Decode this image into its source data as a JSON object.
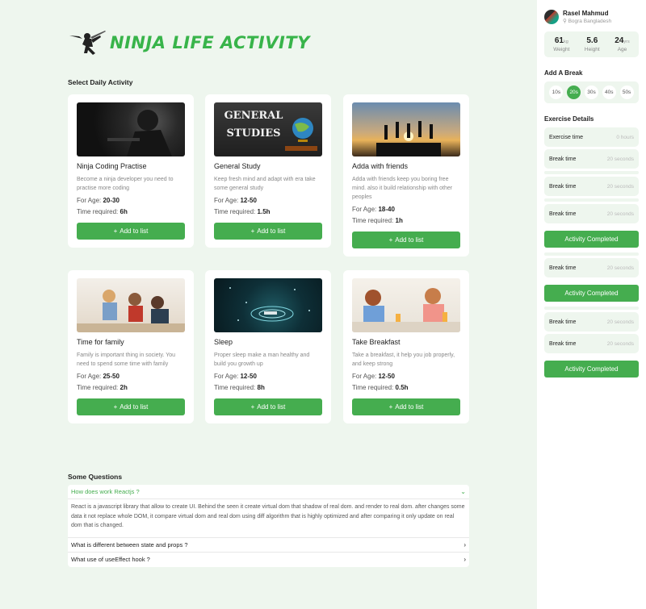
{
  "header": {
    "title": "NINJA LIFE ACTIVITY",
    "logo_icon": "ninja-icon"
  },
  "activities_title": "Select Daily Activity",
  "age_label": "For Age:",
  "time_label": "Time required:",
  "add_label": "Add to list",
  "activities": [
    {
      "title": "Ninja Coding Practise",
      "desc": "Become a ninja developer you need to practise more coding",
      "age": "20-30",
      "time": "6h",
      "image": "hooded-coder"
    },
    {
      "title": "General Study",
      "desc": "Keep fresh mind and adapt with era take some general study",
      "age": "12-50",
      "time": "1.5h",
      "image": "chalkboard-globe",
      "image_text": "GENERAL STUDIES"
    },
    {
      "title": "Adda with friends",
      "desc": "Adda with friends keep you boring free mind. also it build relationship with other peoples",
      "age": "18-40",
      "time": "1h",
      "image": "sunset-friends"
    },
    {
      "title": "Time for family",
      "desc": "Family is important thing in society. You need to spend some time with family",
      "age": "25-50",
      "time": "2h",
      "image": "family-on-floor"
    },
    {
      "title": "Sleep",
      "desc": "Proper sleep make a man healthy and build you growth up",
      "age": "12-50",
      "time": "8h",
      "image": "sleeping-in-space"
    },
    {
      "title": "Take Breakfast",
      "desc": "Take a breakfast, it help you job properly, and keep strong",
      "age": "12-50",
      "time": "0.5h",
      "image": "kids-breakfast"
    }
  ],
  "faq": {
    "title": "Some Questions",
    "items": [
      {
        "q": "How does work Reactjs ?",
        "a": "React is a javascript library that allow to create UI. Behind the seen it create virtual dom that shadow of real dom. and render to real dom. after changes some data it not replace whole DOM, it compare virtual dom and real dom using diff algorithm that is highly optimized and after comparing it only update on real dom that is changed.",
        "open": true
      },
      {
        "q": "What is different between state and props ?",
        "a": "",
        "open": false
      },
      {
        "q": "What use of useEffect hook ?",
        "a": "",
        "open": false
      }
    ]
  },
  "profile": {
    "name": "Rasel Mahmud",
    "location": "Bogra Bangladesh"
  },
  "stats": [
    {
      "value": "61",
      "unit": "kg",
      "label": "Weight"
    },
    {
      "value": "5.6",
      "unit": "",
      "label": "Height"
    },
    {
      "value": "24",
      "unit": "yrs",
      "label": "Age"
    }
  ],
  "break_title": "Add A Break",
  "breaks": [
    "10s",
    "20s",
    "30s",
    "40s",
    "50s"
  ],
  "break_active": "20s",
  "exercise_title": "Exercise Details",
  "exercise_time": {
    "label": "Exercise time",
    "value": "0 hours"
  },
  "break_row": {
    "label": "Break time",
    "value": "20 seconds"
  },
  "completed_label": "Activity Completed",
  "colors": {
    "accent": "#45ad4f",
    "brand": "#38b44a",
    "bg": "#eef6ee"
  }
}
